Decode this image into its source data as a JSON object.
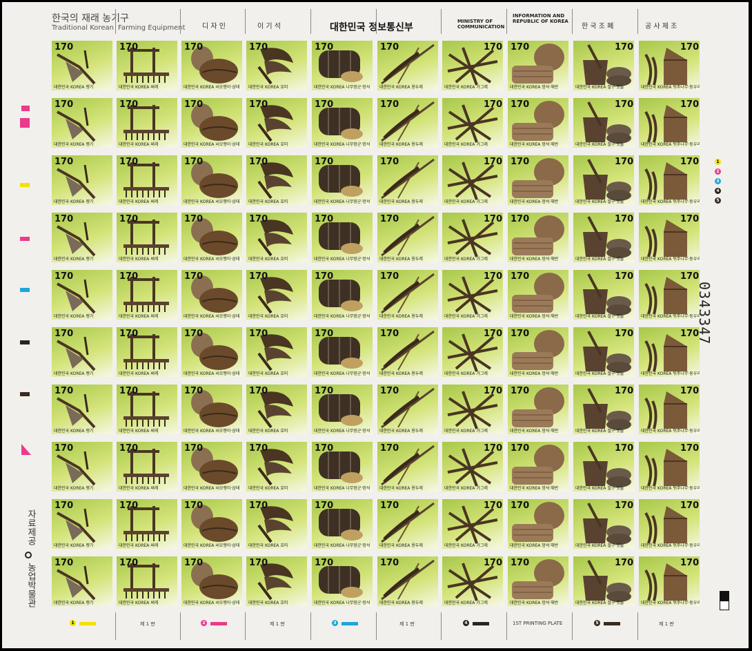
{
  "header": {
    "title_ko": "한국의 재래 농기구",
    "title_en_1": "Traditional Korean",
    "title_en_2": "Farming Equipment",
    "designer_label": "디 자 인",
    "designer_name": "이 기 석",
    "issuer_ko": "대한민국 정보통신부",
    "issuer_en_1": "MINISTRY OF",
    "issuer_en_2": "COMMUNICATION",
    "issuer_en_3": "INFORMATION AND",
    "issuer_en_4": "REPUBLIC OF KOREA",
    "printer_1": "한 국 조 폐",
    "printer_2": "공 사 제 조"
  },
  "stamps": {
    "value": "170",
    "country": "대한민국 KOREA",
    "items": [
      {
        "name": "쟁기",
        "tool": "plow-icon"
      },
      {
        "name": "써레",
        "tool": "harrow-icon"
      },
      {
        "name": "씨오쟁이·삼태",
        "tool": "basket-icon"
      },
      {
        "name": "호미",
        "tool": "hoe-icon"
      },
      {
        "name": "나무장군·멍석",
        "tool": "barrel-icon"
      },
      {
        "name": "용두레",
        "tool": "scoop-icon"
      },
      {
        "name": "가그레",
        "tool": "rack-icon"
      },
      {
        "name": "멍석·채반",
        "tool": "mat-icon"
      },
      {
        "name": "절구·맷돌",
        "tool": "mortar-icon"
      },
      {
        "name": "뒤주나무·둥우리",
        "tool": "granary-icon"
      }
    ],
    "rows": 10,
    "cols": 10
  },
  "margin": {
    "left_vertical_1": "자료제공",
    "left_vertical_2": "농업박물관",
    "serial": "0343347",
    "bottom": [
      "1",
      "제 1 판",
      "2",
      "제 1 판",
      "3",
      "제 1 판",
      "4",
      "1ST PRINTING PLATE",
      "5",
      "제 1 판"
    ]
  },
  "colors": {
    "yellow": "#f2e200",
    "magenta": "#ec3a8c",
    "cyan": "#1ea6dc",
    "black": "#2a2420",
    "brown": "#3a2a20"
  }
}
